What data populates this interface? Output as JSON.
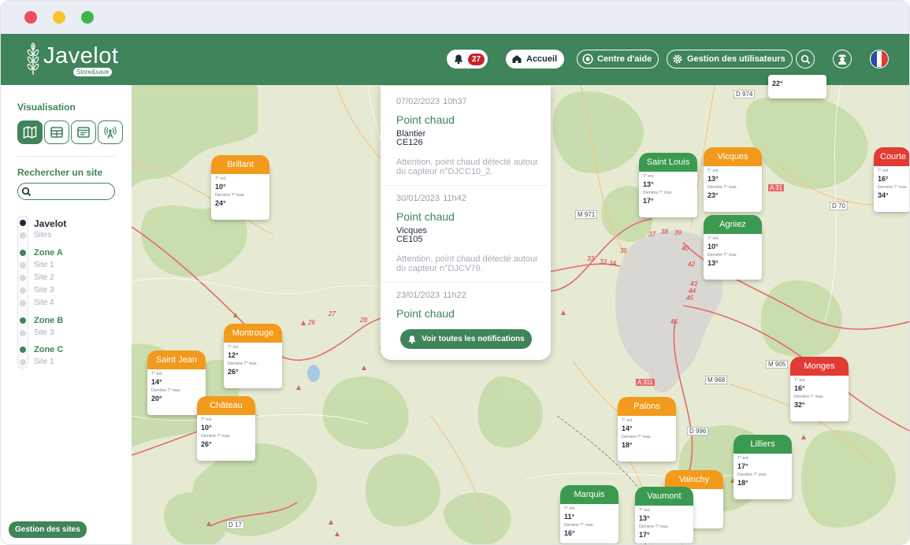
{
  "app": {
    "logo_text": "Javelot",
    "logo_sub": "Store&save"
  },
  "header": {
    "notifications_count": "27",
    "home_label": "Accueil",
    "help_label": "Centre d'aide",
    "users_label": "Gestion des utilisateurs"
  },
  "sidebar": {
    "visualisation_title": "Visualisation",
    "search_title": "Rechercher un site",
    "search_placeholder": "",
    "tree": [
      {
        "label": "Javelot",
        "kind": "main"
      },
      {
        "label": "Sites",
        "kind": "site"
      },
      {
        "label": "Zone A",
        "kind": "zone"
      },
      {
        "label": "Site 1",
        "kind": "site"
      },
      {
        "label": "Site 2",
        "kind": "site"
      },
      {
        "label": "Site 3",
        "kind": "site"
      },
      {
        "label": "Site 4",
        "kind": "site"
      },
      {
        "label": "Zone B",
        "kind": "zone"
      },
      {
        "label": "Site 3",
        "kind": "site"
      },
      {
        "label": "Zone C",
        "kind": "zone"
      },
      {
        "label": "Site 1",
        "kind": "site"
      }
    ],
    "manage_sites_label": "Gestion des sites"
  },
  "notifications": {
    "items": [
      {
        "date": "07/02/2023",
        "time": "10h37",
        "title": "Point chaud",
        "site": "Blantier",
        "code": "CE126",
        "message": "Attention, point chaud détecté autour du capteur n°DJCC10_2."
      },
      {
        "date": "30/01/2023",
        "time": "11h42",
        "title": "Point chaud",
        "site": "Vicques",
        "code": "CE105",
        "message": "Attention, point chaud détecté autour du capteur n°DJCV79."
      },
      {
        "date": "23/01/2023",
        "time": "11h22",
        "title": "Point chaud"
      }
    ],
    "see_all_label": "Voir toutes les notifications"
  },
  "map": {
    "road_labels": [
      "D 974",
      "A 31",
      "D 70",
      "M 971",
      "M 905",
      "A 311",
      "M 968",
      "D 996",
      "D 17",
      "27",
      "28",
      "26",
      "35",
      "37",
      "38",
      "39",
      "40",
      "33",
      "33",
      "34",
      "42",
      "43",
      "44",
      "45",
      "46"
    ],
    "card_label_temp": "T° ext.",
    "card_label_max": "Dernière T° max.",
    "sites": [
      {
        "name": "Brillant",
        "color": "orange",
        "temp": "10°",
        "max": "24°"
      },
      {
        "name": "Montrouge",
        "color": "orange",
        "temp": "12°",
        "max": "26°"
      },
      {
        "name": "Saint Jean",
        "color": "orange",
        "temp": "14°",
        "max": "20°"
      },
      {
        "name": "Château",
        "color": "orange",
        "temp": "10°",
        "max": "26°"
      },
      {
        "name": "Saint Louis",
        "color": "green",
        "temp": "13°",
        "max": "17°"
      },
      {
        "name": "Vicques",
        "color": "orange",
        "temp": "13°",
        "max": "23°"
      },
      {
        "name": "Agniez",
        "color": "green",
        "temp": "10°",
        "max": "13°"
      },
      {
        "name": "Courte",
        "color": "red",
        "temp": "16°",
        "max": "34°"
      },
      {
        "name": "Monges",
        "color": "red",
        "temp": "16°",
        "max": "32°"
      },
      {
        "name": "Palons",
        "color": "orange",
        "temp": "14°",
        "max": "18°"
      },
      {
        "name": "Lilliers",
        "color": "green",
        "temp": "17°",
        "max": "18°"
      },
      {
        "name": "Vainchy",
        "color": "orange",
        "temp": "",
        "max": ""
      },
      {
        "name": "Marquis",
        "color": "green",
        "temp": "11°",
        "max": "16°"
      },
      {
        "name": "Vaumont",
        "color": "green",
        "temp": "13°",
        "max": "17°"
      },
      {
        "name": "",
        "color": "white",
        "temp": "",
        "max": "22°"
      }
    ]
  },
  "colors": {
    "brand_green": "#3f845a",
    "orange": "#f29a1b",
    "green": "#3b9a4f",
    "red": "#e23b34",
    "badge_red": "#c8202e"
  }
}
